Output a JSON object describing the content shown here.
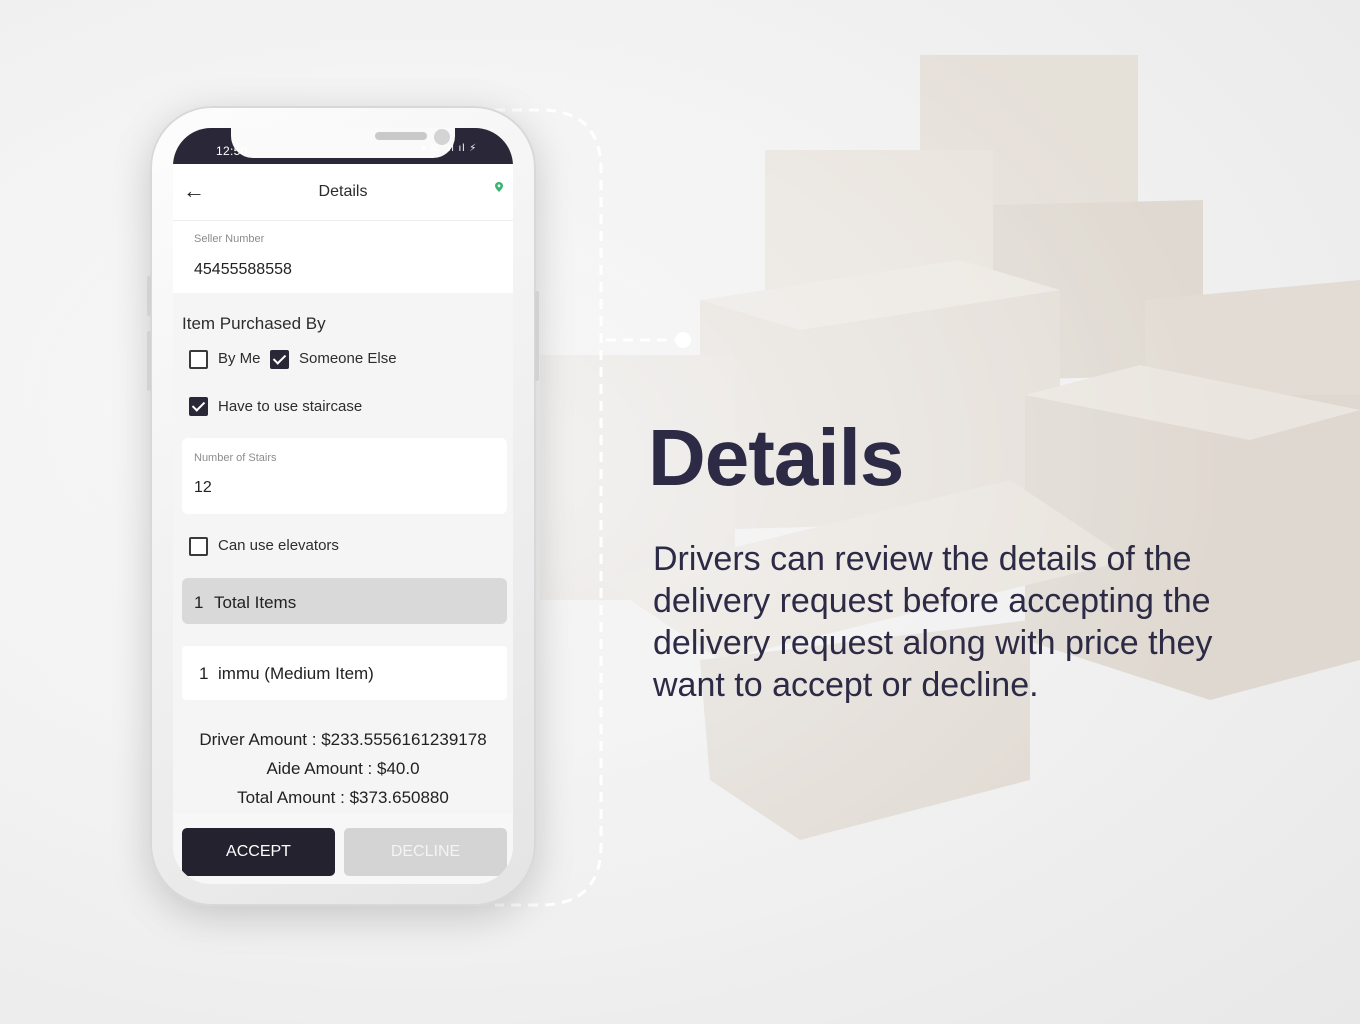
{
  "status_bar": {
    "time": "12:50",
    "icons": "▾ ⊞ .ıl ıl ⚡"
  },
  "header": {
    "title": "Details",
    "back_icon": "arrow-left-icon",
    "location_icon": "map-pin-icon"
  },
  "seller": {
    "label": "Seller Number",
    "value": "45455588558"
  },
  "purchased_by": {
    "heading": "Item Purchased By",
    "options": [
      {
        "label": "By Me",
        "checked": false
      },
      {
        "label": "Someone Else",
        "checked": true
      }
    ]
  },
  "staircase": {
    "label": "Have to use staircase",
    "checked": true
  },
  "stairs": {
    "label": "Number of Stairs",
    "value": "12"
  },
  "elevators": {
    "label": "Can use elevators",
    "checked": false
  },
  "total_items": {
    "count": "1",
    "label": "Total Items"
  },
  "items": [
    {
      "qty": "1",
      "name": "immu (Medium Item)"
    }
  ],
  "amounts": {
    "driver": "Driver Amount : $233.5556161239178",
    "aide": "Aide Amount : $40.0",
    "total": "Total Amount : $373.650880"
  },
  "actions": {
    "accept": "ACCEPT",
    "decline": "DECLINE"
  },
  "promo": {
    "headline": "Details",
    "description": "Drivers can review the details of the delivery request before accepting the delivery request along with price they want to accept or decline."
  },
  "colors": {
    "accent": "#2a2838",
    "headline": "#2c2a45",
    "pin": "#3cb371"
  }
}
